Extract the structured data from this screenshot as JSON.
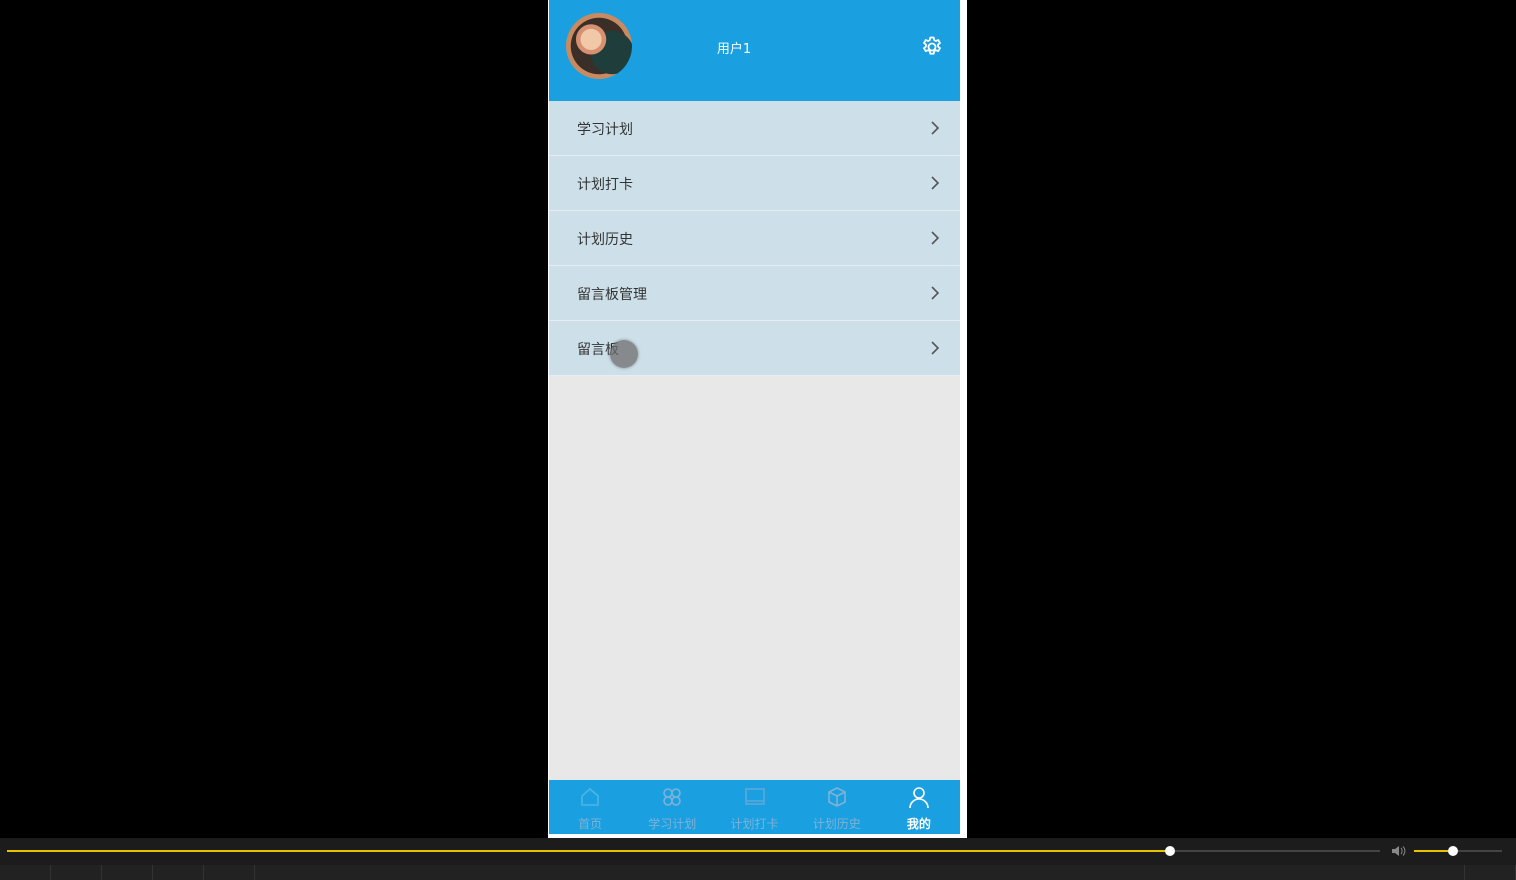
{
  "header": {
    "username": "用户1"
  },
  "menu": [
    {
      "label": "学习计划"
    },
    {
      "label": "计划打卡"
    },
    {
      "label": "计划历史"
    },
    {
      "label": "留言板管理"
    },
    {
      "label": "留言板"
    }
  ],
  "tabbar": {
    "tabs": [
      {
        "label": "首页",
        "icon": "home-icon",
        "active": false
      },
      {
        "label": "学习计划",
        "icon": "grid-icon",
        "active": false
      },
      {
        "label": "计划打卡",
        "icon": "checkin-icon",
        "active": false
      },
      {
        "label": "计划历史",
        "icon": "box-icon",
        "active": false
      },
      {
        "label": "我的",
        "icon": "user-icon",
        "active": true
      }
    ]
  },
  "player": {
    "progress": 0.847,
    "volume": 0.44
  },
  "colors": {
    "primary": "#1a9fe0",
    "menu_bg": "#cde0ea",
    "accent": "#e8c400"
  }
}
